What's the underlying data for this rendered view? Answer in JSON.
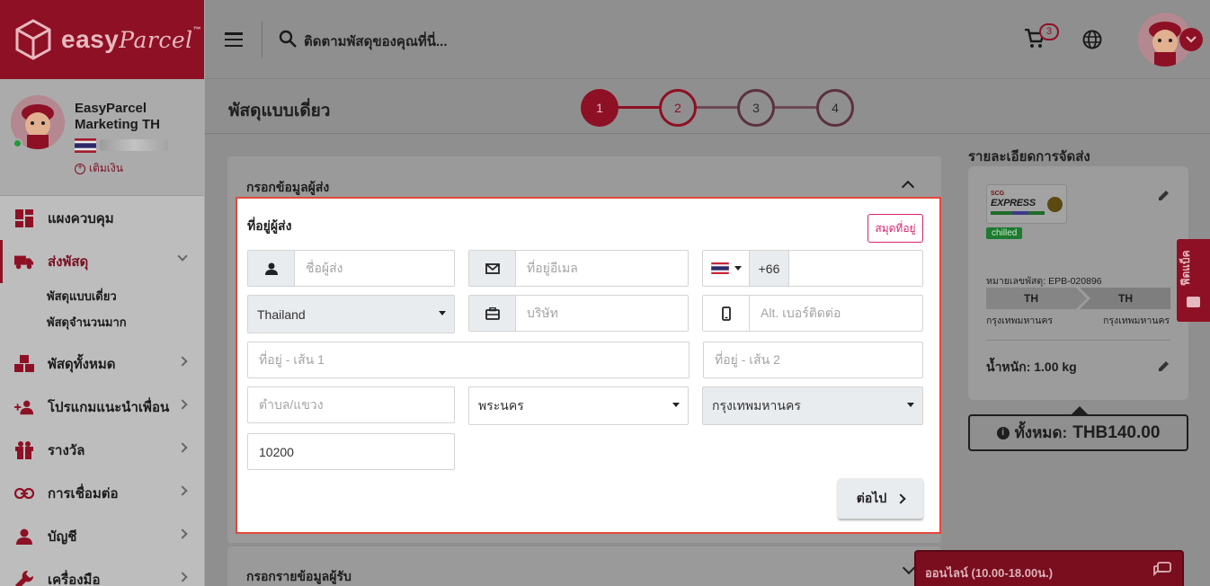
{
  "brand": {
    "logo_text": "easy",
    "logo_script": "Parcel",
    "tm": "™"
  },
  "header": {
    "search_placeholder": "ติดตามพัสดุของคุณที่นี่...",
    "cart_count": "3"
  },
  "profile": {
    "name": "EasyParcel Marketing TH",
    "topup_label": "เติมเงิน",
    "status": "online"
  },
  "sidebar": {
    "items": [
      {
        "label": "แผงควบคุม",
        "icon": "dashboard-icon"
      },
      {
        "label": "ส่งพัสดุ",
        "icon": "truck-icon",
        "active": true,
        "children": [
          {
            "label": "พัสดุแบบเดี่ยว"
          },
          {
            "label": "พัสดุจำนวนมาก"
          }
        ]
      },
      {
        "label": "พัสดุทั้งหมด",
        "icon": "boxes-icon"
      },
      {
        "label": "โปรแกมแนะนำเพื่อน",
        "icon": "referral-icon"
      },
      {
        "label": "รางวัล",
        "icon": "gift-icon"
      },
      {
        "label": "การเชื่อมต่อ",
        "icon": "link-icon"
      },
      {
        "label": "บัญชี",
        "icon": "user-icon"
      },
      {
        "label": "เครื่องมือ",
        "icon": "wrench-icon"
      }
    ]
  },
  "page": {
    "title": "พัสดุแบบเดี่ยว",
    "steps": [
      "1",
      "2",
      "3",
      "4"
    ],
    "current_step": 2
  },
  "sender": {
    "section_title": "กรอกข้อมูลผู้ส่ง",
    "form_title": "ที่อยู่ผู้ส่ง",
    "address_book": "สมุดที่อยู่",
    "name_placeholder": "ชื่อผู้ส่ง",
    "email_placeholder": "ที่อยู่อีเมล",
    "phone_code": "+66",
    "phone_value": "",
    "country": "Thailand",
    "company_placeholder": "บริษัท",
    "alt_phone_placeholder": "Alt. เบอร์ติดต่อ",
    "address1_placeholder": "ที่อยู่ - เส้น 1",
    "address2_placeholder": "ที่อยู่ - เส้น 2",
    "subdistrict_placeholder": "ตำบล/แขวง",
    "district": "พระนคร",
    "province": "กรุงเทพมหานคร",
    "postcode": "10200",
    "next_label": "ต่อไป"
  },
  "receiver": {
    "section_title": "กรอกรายข้อมูลผู้รับ"
  },
  "summary": {
    "title": "รายละเอียดการจัดส่ง",
    "courier_line1": "SCG",
    "courier_line2": "EXPRESS",
    "service_tag": "chilled",
    "parcel_no": "หมายเลขพัสดุ: EPB-020896",
    "from_country": "TH",
    "to_country": "TH",
    "from_city": "กรุงเทพมหานคร",
    "to_city": "กรุงเทพมหานคร",
    "weight": "น้ำหนัก:  1.00 kg",
    "total_label": "ทั้งหมด:",
    "total_value": "THB140.00"
  },
  "feedback_label": "ฟีดแบ็ค",
  "chat_label": "ออนไลน์ (10.00-18.00น.)",
  "colors": {
    "brand": "#8e1024",
    "accent_pink": "#d6246e",
    "highlight_border": "#e4483b"
  }
}
